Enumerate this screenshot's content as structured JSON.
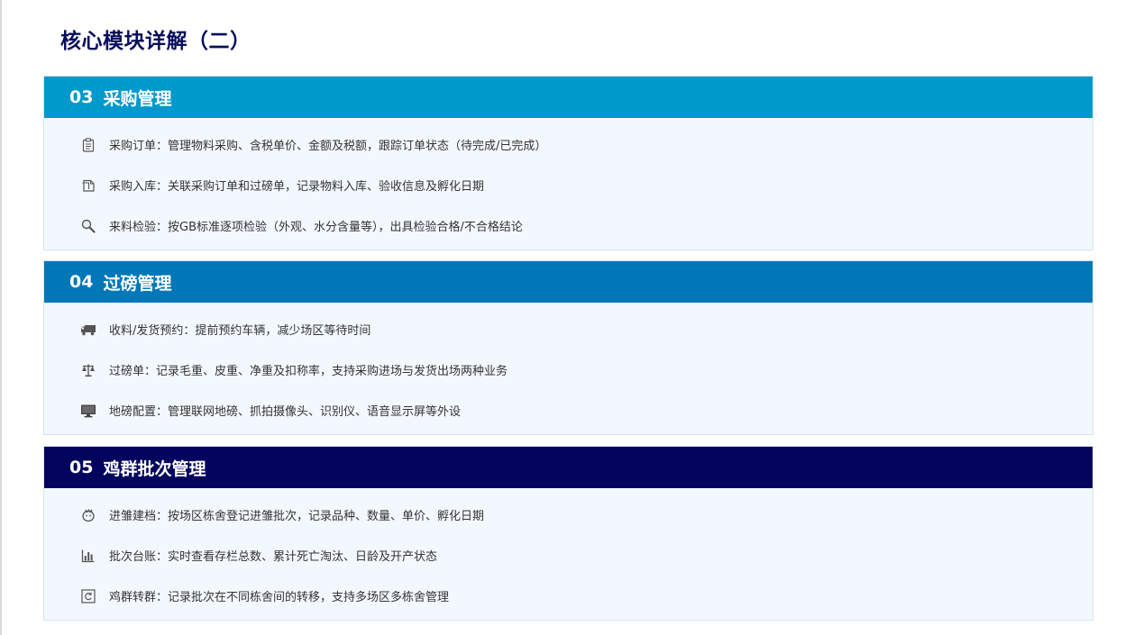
{
  "page": {
    "title": "核心模块详解（二）"
  },
  "sections": [
    {
      "number": "03",
      "title": "采购管理",
      "color": "#0099cc",
      "items": [
        {
          "icon": "clipboard-icon",
          "text": "采购订单：管理物料采购、含税单价、金额及税额，跟踪订单状态（待完成/已完成）"
        },
        {
          "icon": "package-icon",
          "text": "采购入库：关联采购订单和过磅单，记录物料入库、验收信息及孵化日期"
        },
        {
          "icon": "magnifier-icon",
          "text": "来料检验：按GB标准逐项检验（外观、水分含量等），出具检验合格/不合格结论"
        }
      ]
    },
    {
      "number": "04",
      "title": "过磅管理",
      "color": "#0077b6",
      "items": [
        {
          "icon": "truck-icon",
          "text": "收料/发货预约：提前预约车辆，减少场区等待时间"
        },
        {
          "icon": "scale-icon",
          "text": "过磅单：记录毛重、皮重、净重及扣称率，支持采购进场与发货出场两种业务"
        },
        {
          "icon": "monitor-icon",
          "text": "地磅配置：管理联网地磅、抓拍摄像头、识别仪、语音显示屏等外设"
        }
      ]
    },
    {
      "number": "05",
      "title": "鸡群批次管理",
      "color": "#03045e",
      "items": [
        {
          "icon": "chick-icon",
          "text": "进雏建档：按场区栋舍登记进雏批次，记录品种、数量、单价、孵化日期"
        },
        {
          "icon": "bar-chart-icon",
          "text": "批次台账：实时查看存栏总数、累计死亡淘汰、日龄及开产状态"
        },
        {
          "icon": "transfer-icon",
          "text": "鸡群转群：记录批次在不同栋舍间的转移，支持多场区多栋舍管理"
        }
      ]
    }
  ]
}
